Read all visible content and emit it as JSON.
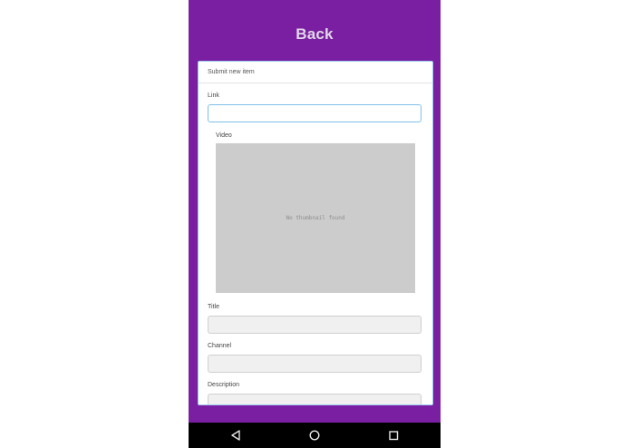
{
  "header": {
    "title": "Back"
  },
  "form": {
    "header": "Submit new item",
    "link": {
      "label": "Link",
      "value": ""
    },
    "video": {
      "label": "Video",
      "thumbnail_text": "No thumbnail found"
    },
    "title": {
      "label": "Title",
      "value": ""
    },
    "channel": {
      "label": "Channel",
      "value": ""
    },
    "description": {
      "label": "Description",
      "value": ""
    }
  },
  "navbar": {
    "icons": [
      "back-triangle-icon",
      "home-circle-icon",
      "recents-square-icon"
    ]
  },
  "colors": {
    "primary": "#7b1fa2",
    "focus_border": "#7ec0e8",
    "thumbnail_bg": "#cccccc"
  }
}
